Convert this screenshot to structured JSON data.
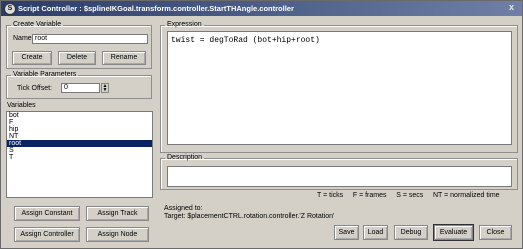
{
  "window": {
    "title": "Script Controller : $splineIKGoal.transform.controller.StartTHAngle.controller",
    "title_icon": "S",
    "close_glyph": "x"
  },
  "create_variable": {
    "legend": "Create Variable",
    "name_label": "Name:",
    "name_value": "root",
    "create_label": "Create",
    "delete_label": "Delete",
    "rename_label": "Rename"
  },
  "variable_parameters": {
    "legend": "Variable Parameters",
    "tick_offset_label": "Tick Offset:",
    "tick_offset_value": "0"
  },
  "variables": {
    "label": "Variables",
    "items": [
      "bot",
      "F",
      "hip",
      "NT",
      "root",
      "S",
      "T"
    ],
    "selected": "root"
  },
  "expression": {
    "legend": "Expression",
    "text": "twist = degToRad (bot+hip+root)"
  },
  "description": {
    "legend": "Description",
    "text": ""
  },
  "legend_hint": "T = ticks     F = frames     S = secs     NT = normalized time",
  "assigned": {
    "line1": "Assigned to:",
    "line2": "Target: $placementCTRL.rotation.controller.'Z Rotation'"
  },
  "buttons": {
    "assign_constant": "Assign Constant",
    "assign_track": "Assign Track",
    "assign_controller": "Assign Controller",
    "assign_node": "Assign Node",
    "save": "Save",
    "load": "Load",
    "debug": "Debug",
    "evaluate": "Evaluate",
    "close": "Close"
  }
}
